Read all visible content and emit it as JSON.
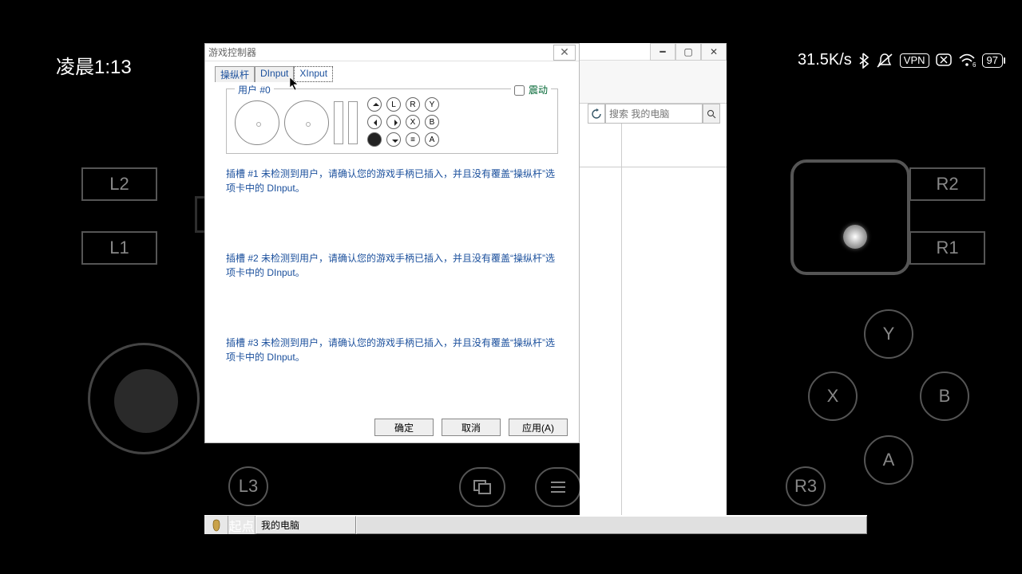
{
  "status": {
    "time": "凌晨1:13",
    "net_speed": "31.5K/s",
    "vpn_label": "VPN",
    "battery": "97"
  },
  "overlay": {
    "l1": "L1",
    "l2": "L2",
    "l3": "L3",
    "r1": "R1",
    "r2": "R2",
    "r3": "R3",
    "y": "Y",
    "x": "X",
    "b": "B",
    "a": "A"
  },
  "dialog": {
    "title": "游戏控制器",
    "tabs": [
      "操纵杆",
      "DInput",
      "XInput"
    ],
    "group_legend": "用户 #0",
    "vibrate_label": "震动",
    "pad_labels": {
      "L": "L",
      "R": "R",
      "Y": "Y",
      "X": "X",
      "B": "B",
      "A": "A"
    },
    "slots": [
      "插槽 #1 未检测到用户，请确认您的游戏手柄已插入，并且没有覆盖“操纵杆”选项卡中的 DInput。",
      "插槽 #2 未检测到用户，请确认您的游戏手柄已插入，并且没有覆盖“操纵杆”选项卡中的 DInput。",
      "插槽 #3 未检测到用户，请确认您的游戏手柄已插入，并且没有覆盖“操纵杆”选项卡中的 DInput。"
    ],
    "ok": "确定",
    "cancel": "取消",
    "apply": "应用(A)"
  },
  "bg_window": {
    "search_placeholder": "搜索 我的电脑"
  },
  "taskbar": {
    "start": "起点",
    "task": "我的电脑"
  }
}
